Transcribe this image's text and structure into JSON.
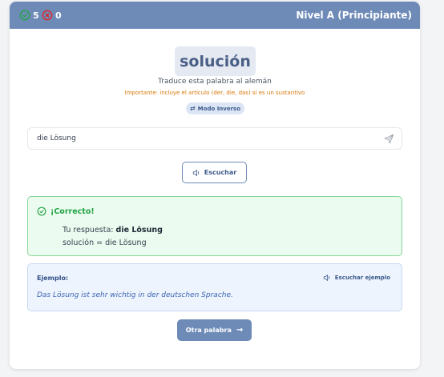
{
  "header": {
    "correct_count": "5",
    "wrong_count": "0",
    "level": "Nivel A (Principiante)"
  },
  "question": {
    "word": "solución",
    "instruction": "Traduce esta palabra al alemán",
    "important_note": "Importante: incluye el artículo (der, die, das) si es un sustantivo",
    "mode_label": "Modo Inverso",
    "mode_icon": "swap-arrows-icon"
  },
  "answer_input": {
    "value": "die Lösung",
    "send_icon": "send-icon"
  },
  "listen_button": {
    "label": "Escuchar",
    "icon": "speaker-icon"
  },
  "feedback": {
    "title": "¡Correcto!",
    "your_answer_label": "Tu respuesta:",
    "your_answer_value": "die Lösung",
    "equation": "solución = die Lösung"
  },
  "example": {
    "label": "Ejemplo:",
    "listen_label": "Escuchar ejemplo",
    "sentence": "Das Lösung ist sehr wichtig in der deutschen Sprache."
  },
  "next_button": {
    "label": "Otra palabra",
    "arrow": "→"
  },
  "colors": {
    "header": "#6e8bb8",
    "correct_green": "#22a447",
    "wrong_red": "#dc2626",
    "warning_orange": "#d97706"
  }
}
